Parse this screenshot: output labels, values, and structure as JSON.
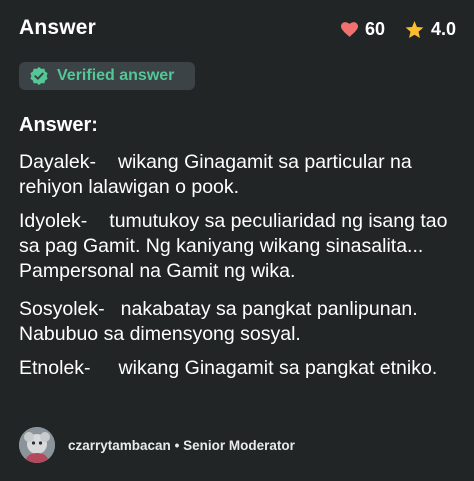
{
  "header": {
    "title": "Answer",
    "likes": "60",
    "rating": "4.0"
  },
  "badge": {
    "label": "Verified answer"
  },
  "answer": {
    "heading": "Answer:",
    "paragraphs": [
      {
        "term": "Dayalek-",
        "text": "wikang Ginagamit sa particular na rehiyon lalawigan o pook."
      },
      {
        "term": "Idyolek-",
        "text": "tumutukoy sa peculiaridad ng isang tao sa pag Gamit. Ng kaniyang wikang sinasalita... Pampersonal na Gamit ng wika."
      },
      {
        "term": "Sosyolek-",
        "text": "nakabatay sa pangkat panlipunan. Nabubuo sa dimensyong sosyal."
      },
      {
        "term": "Etnolek-",
        "text": "wikang Ginagamit sa pangkat etniko."
      }
    ]
  },
  "footer": {
    "username": "czarrytambacan",
    "separator": "•",
    "role": "Senior Moderator"
  },
  "colors": {
    "background": "#212526",
    "heart": "#f2706f",
    "star": "#fbbe2e",
    "verified": "#53c796"
  }
}
